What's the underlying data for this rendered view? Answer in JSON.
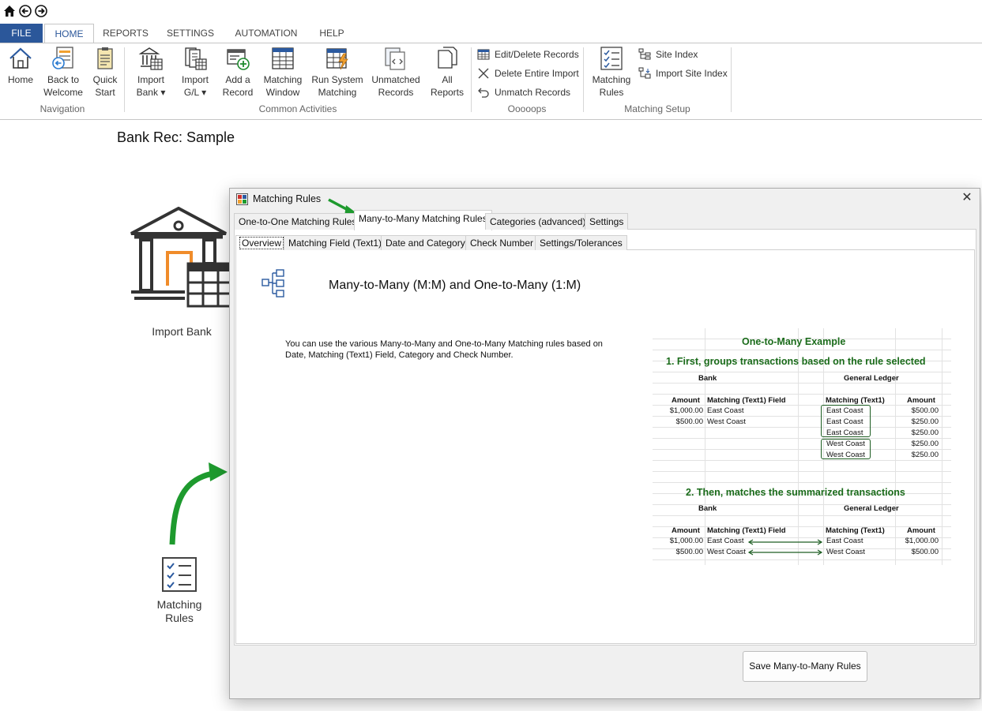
{
  "ribbon": {
    "tabs": [
      "FILE",
      "HOME",
      "REPORTS",
      "SETTINGS",
      "AUTOMATION",
      "HELP"
    ],
    "active_tab": "HOME",
    "buttons": {
      "home": "Home",
      "back_welcome": [
        "Back to",
        "Welcome"
      ],
      "quick_start": [
        "Quick",
        "Start"
      ],
      "import_bank": [
        "Import",
        "Bank"
      ],
      "import_gl": [
        "Import",
        "G/L"
      ],
      "add_record": [
        "Add a",
        "Record"
      ],
      "matching_window": [
        "Matching",
        "Window"
      ],
      "run_system_matching": [
        "Run System",
        "Matching"
      ],
      "unmatched_records": [
        "Unmatched",
        "Records"
      ],
      "all_reports": [
        "All",
        "Reports"
      ],
      "edit_delete": "Edit/Delete Records",
      "delete_import": "Delete Entire Import",
      "unmatch_records": "Unmatch Records",
      "matching_rules": [
        "Matching",
        "Rules"
      ],
      "site_index": "Site Index",
      "import_site_index": "Import Site Index"
    },
    "groups": {
      "navigation": "Navigation",
      "common": "Common Activities",
      "oooops": "Ooooops",
      "setup": "Matching Setup"
    }
  },
  "page": {
    "title": "Bank Rec: Sample",
    "import_bank_label": "Import Bank",
    "matching_rules_label": [
      "Matching",
      "Rules"
    ]
  },
  "dialog": {
    "title": "Matching Rules",
    "tabs": [
      "One-to-One Matching Rules",
      "Many-to-Many Matching Rules",
      "Categories (advanced)",
      "Settings"
    ],
    "selected_tab": "Many-to-Many Matching Rules",
    "subtabs": [
      "Overview",
      "Matching Field (Text1)",
      "Date and Category",
      "Check Number",
      "Settings/Tolerances"
    ],
    "selected_subtab": "Overview",
    "heading": "Many-to-Many (M:M) and One-to-Many (1:M)",
    "description": "You can use the various Many-to-Many and One-to-Many Matching rules based on Date, Matching (Text1) Field, Category and Check Number.",
    "save_button": "Save Many-to-Many Rules"
  },
  "example": {
    "title": "One-to-Many Example",
    "step1": "1. First, groups transactions based on the rule selected",
    "step2": "2. Then, matches the summarized transactions",
    "bank": "Bank",
    "gl": "General Ledger",
    "col_amount": "Amount",
    "col_field": "Matching (Text1) Field",
    "col_text1": "Matching (Text1)",
    "col_amount2": "Amount",
    "s1_bank": [
      [
        "$1,000.00",
        "East Coast"
      ],
      [
        "$500.00",
        "West Coast"
      ]
    ],
    "s1_gl": [
      [
        "East Coast",
        "$500.00"
      ],
      [
        "East Coast",
        "$250.00"
      ],
      [
        "East Coast",
        "$250.00"
      ],
      [
        "West Coast",
        "$250.00"
      ],
      [
        "West Coast",
        "$250.00"
      ]
    ],
    "s2_bank": [
      [
        "$1,000.00",
        "East Coast"
      ],
      [
        "$500.00",
        "West Coast"
      ]
    ],
    "s2_gl": [
      [
        "East Coast",
        "$1,000.00"
      ],
      [
        "West Coast",
        "$500.00"
      ]
    ]
  },
  "colors": {
    "file_tab": "#2b579a",
    "accent_green": "#1e9a2e",
    "example_green": "#1a6b1a"
  }
}
